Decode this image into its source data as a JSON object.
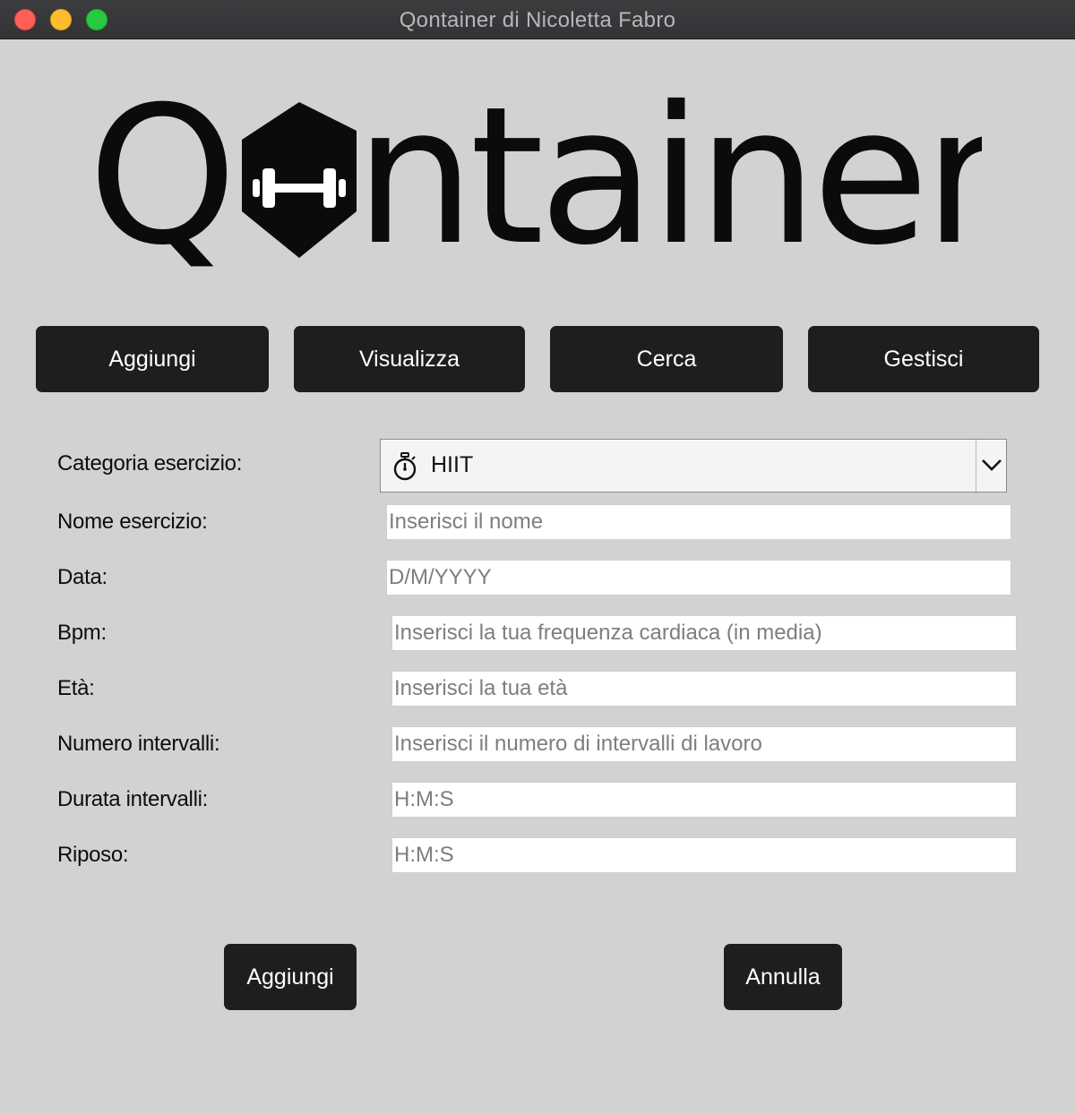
{
  "window": {
    "title": "Qontainer di Nicoletta Fabro"
  },
  "logo": {
    "text_prefix": "Q",
    "text_suffix": "ntainer",
    "icon": "dumbbell-hexagon-icon"
  },
  "nav": {
    "items": [
      {
        "label": "Aggiungi"
      },
      {
        "label": "Visualizza"
      },
      {
        "label": "Cerca"
      },
      {
        "label": "Gestisci"
      }
    ]
  },
  "form": {
    "category": {
      "label": "Categoria esercizio:",
      "value": "HIIT",
      "icon": "stopwatch-icon"
    },
    "name": {
      "label": "Nome esercizio:",
      "placeholder": "Inserisci il nome"
    },
    "date": {
      "label": "Data:",
      "placeholder": "D/M/YYYY"
    },
    "bpm": {
      "label": "Bpm:",
      "placeholder": "Inserisci la tua frequenza cardiaca (in media)"
    },
    "age": {
      "label": "Età:",
      "placeholder": "Inserisci la tua età"
    },
    "intervals": {
      "label": "Numero intervalli:",
      "placeholder": "Inserisci il numero di intervalli di lavoro"
    },
    "interval_duration": {
      "label": "Durata intervalli:",
      "placeholder": "H:M:S"
    },
    "rest": {
      "label": "Riposo:",
      "placeholder": "H:M:S"
    }
  },
  "actions": {
    "add_label": "Aggiungi",
    "cancel_label": "Annulla"
  }
}
